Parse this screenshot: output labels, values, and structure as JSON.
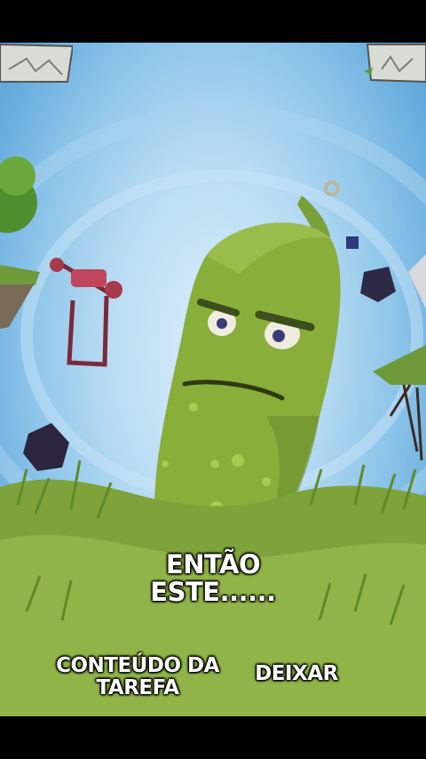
{
  "dialogue": {
    "line": "ENTÃO ESTE......",
    "line_parts": [
      "ENTÃO",
      "ESTE......"
    ]
  },
  "options": {
    "task_content": "CONTEÚDO DA TAREFA",
    "leave": "DEIXAR"
  },
  "colors": {
    "sky": "#8fc6ea",
    "pickle": "#8aae3a",
    "grass": "#7da33a"
  },
  "icons": {
    "left_hud": "stone-panel-icon",
    "right_hud": "stone-panel-icon"
  }
}
